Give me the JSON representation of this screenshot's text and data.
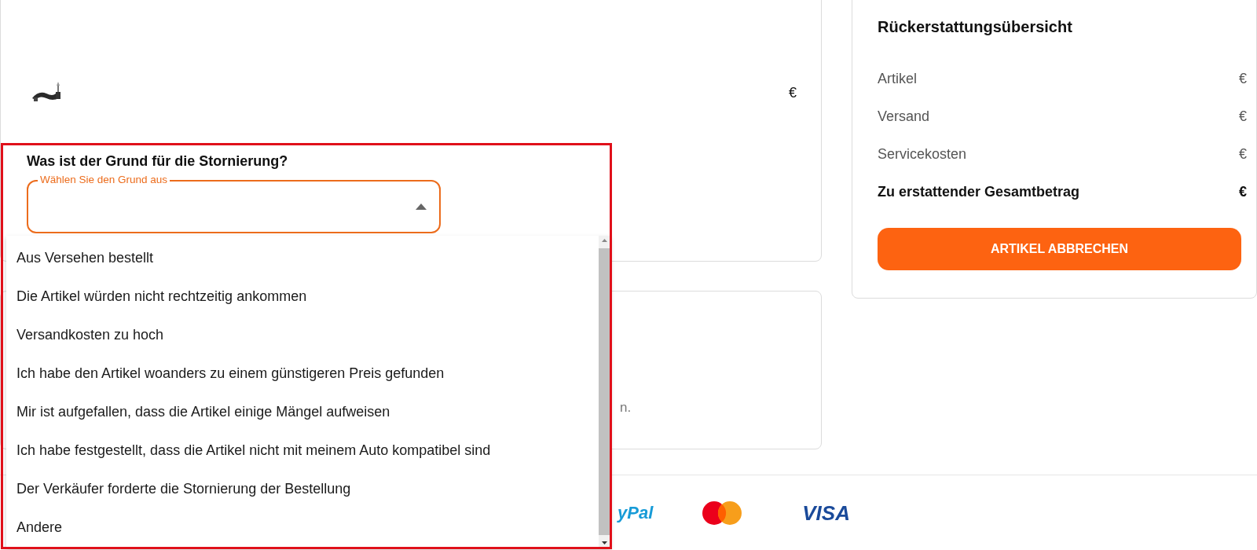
{
  "product": {
    "price": "€"
  },
  "reason": {
    "question": "Was ist der Grund für die Stornierung?",
    "select": {
      "label": "Wählen Sie den Grund aus",
      "expanded": true
    },
    "options": [
      {
        "label": "Aus Versehen bestellt",
        "selected": false
      },
      {
        "label": "Die Artikel würden nicht rechtzeitig ankommen",
        "selected": false
      },
      {
        "label": "Versandkosten zu hoch",
        "selected": false
      },
      {
        "label": "Ich habe den Artikel woanders zu einem günstigeren Preis gefunden",
        "selected": false
      },
      {
        "label": "Mir ist aufgefallen, dass die Artikel einige Mängel aufweisen",
        "selected": false
      },
      {
        "label": "Ich habe festgestellt, dass die Artikel nicht mit meinem Auto kompatibel sind",
        "selected": false
      },
      {
        "label": "Der Verkäufer forderte die Stornierung der Bestellung",
        "selected": false
      },
      {
        "label": "Andere",
        "selected": false
      }
    ]
  },
  "note": {
    "text": "n."
  },
  "summary": {
    "title": "Rückerstattungsübersicht",
    "rows": [
      {
        "kind": "line",
        "label": "Artikel",
        "value": "€"
      },
      {
        "kind": "line",
        "label": "Versand",
        "value": "€"
      },
      {
        "kind": "line",
        "label": "Servicekosten",
        "value": "€"
      },
      {
        "kind": "total",
        "label": "Zu erstattender Gesamtbetrag",
        "value": "€"
      }
    ],
    "button": "ARTIKEL ABBRECHEN"
  },
  "payment_logos": [
    {
      "kind": "paypal",
      "text": "yPal"
    },
    {
      "kind": "mastercard"
    },
    {
      "kind": "visa",
      "text": "VISA"
    }
  ],
  "highlight_frame": true
}
